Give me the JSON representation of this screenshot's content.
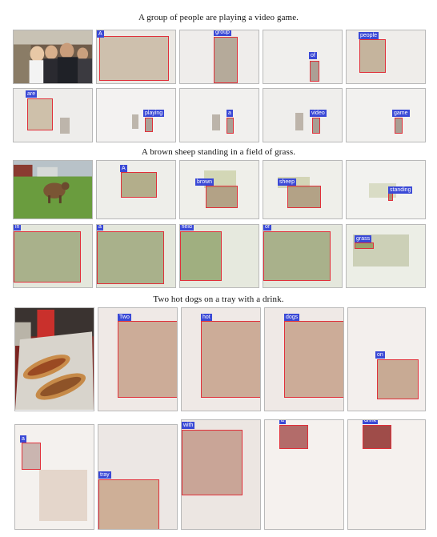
{
  "figure": {
    "captions": [
      "A group of people are playing a video game.",
      "A brown sheep standing in a field of grass.",
      "Two hot dogs on a tray with a drink."
    ],
    "rows": [
      {
        "group": 0,
        "words": [
          "A",
          "group",
          "of",
          "people"
        ]
      },
      {
        "group": 0,
        "words": [
          "are",
          "playing",
          "a",
          "video",
          "game"
        ]
      },
      {
        "group": 1,
        "words": [
          "A",
          "brown",
          "sheep",
          "standing"
        ]
      },
      {
        "group": 1,
        "words": [
          "in",
          "a",
          "field",
          "of",
          "grass"
        ]
      },
      {
        "group": 2,
        "words": [
          "Two",
          "hot",
          "dogs",
          "on"
        ]
      },
      {
        "group": 2,
        "words": [
          "a",
          "tray",
          "with",
          "a",
          "drink"
        ]
      }
    ]
  },
  "colors": {
    "word_tag_bg": "#3a49d6",
    "attention_box": "#e0303a",
    "tile_border": "#b9b9b9"
  }
}
